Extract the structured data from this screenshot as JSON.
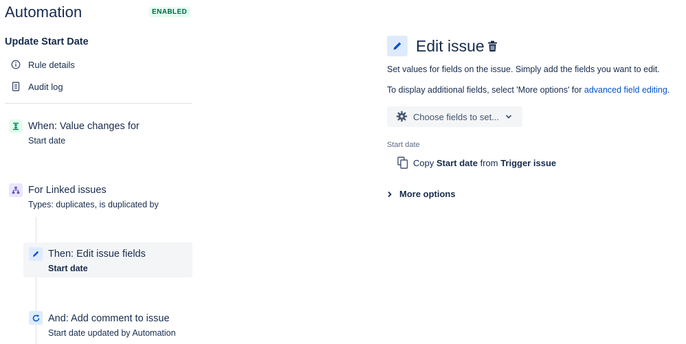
{
  "app": {
    "title": "Automation",
    "status": "ENABLED"
  },
  "rule": {
    "name": "Update Start Date"
  },
  "nav": {
    "rule_details": "Rule details",
    "audit_log": "Audit log"
  },
  "steps": {
    "trigger": {
      "title": "When: Value changes for",
      "subtitle": "Start date",
      "icon": "trigger-icon"
    },
    "branch": {
      "title": "For Linked issues",
      "subtitle": "Types: duplicates, is duplicated by",
      "icon": "branch-icon"
    },
    "action1": {
      "title": "Then: Edit issue fields",
      "subtitle": "Start date",
      "icon": "pencil-icon"
    },
    "action2": {
      "title": "And: Add comment to issue",
      "subtitle": "Start date updated by Automation",
      "icon": "comment-refresh-icon"
    }
  },
  "panel": {
    "title": "Edit issue",
    "description": "Set values for fields on the issue. Simply add the fields you want to edit.",
    "additional_prefix": "To display additional fields, select 'More options' for ",
    "additional_link": "advanced field editing",
    "additional_suffix": ".",
    "choose_fields": "Choose fields to set...",
    "field_label": "Start date",
    "copy": {
      "verb": "Copy",
      "field": "Start date",
      "from": "from",
      "source": "Trigger issue"
    },
    "more_options": "More options"
  },
  "colors": {
    "text": "#172b4d",
    "link": "#0052cc",
    "enabled_bg": "#e3fcef",
    "enabled_text": "#006644",
    "selected_card": "#f4f5f7"
  }
}
